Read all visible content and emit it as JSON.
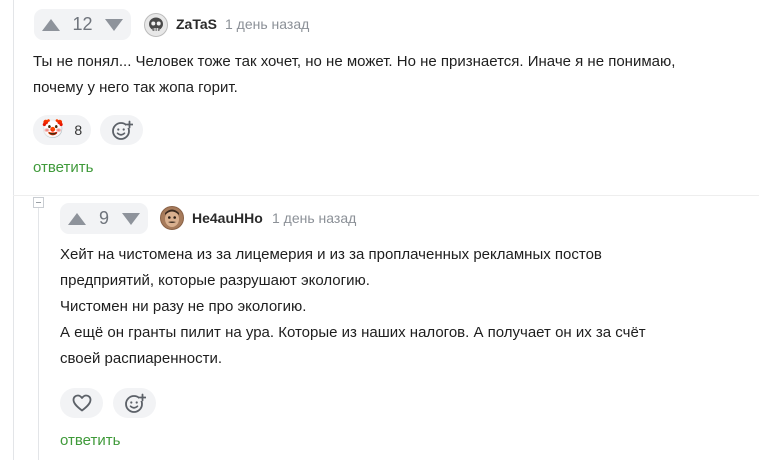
{
  "comment1": {
    "vote_count": "12",
    "author": "ZaTaS",
    "time": "1 день назад",
    "text_lines": [
      "Ты не понял... Человек тоже так хочет, но не может. Но не признается. Иначе я не понимаю,",
      "почему у него так жопа горит."
    ],
    "reaction_emoji": "🤡",
    "reaction_count": "8",
    "reply_label": "ответить"
  },
  "comment2": {
    "vote_count": "9",
    "author": "He4auHHo",
    "time": "1 день назад",
    "text_lines": [
      "Хейт на чистомена из за лицемерия и из за проплаченных рекламных постов",
      "предприятий, которые разрушают экологию.",
      "Чистомен ни разу не про экологию.",
      "А ещё он гранты пилит на ура. Которые из наших налогов. А получает он их за счёт",
      "своей распиаренности."
    ],
    "reply_label": "ответить"
  },
  "colors": {
    "accent_green": "#3f9a3a",
    "muted_gray": "#8e939b",
    "pill_bg": "#f2f3f5"
  },
  "icons": {
    "upvote": "arrow-up-icon",
    "downvote": "arrow-down-icon",
    "add_reaction": "smiley-plus-icon",
    "like": "heart-icon",
    "collapse": "collapse-minus-icon"
  }
}
